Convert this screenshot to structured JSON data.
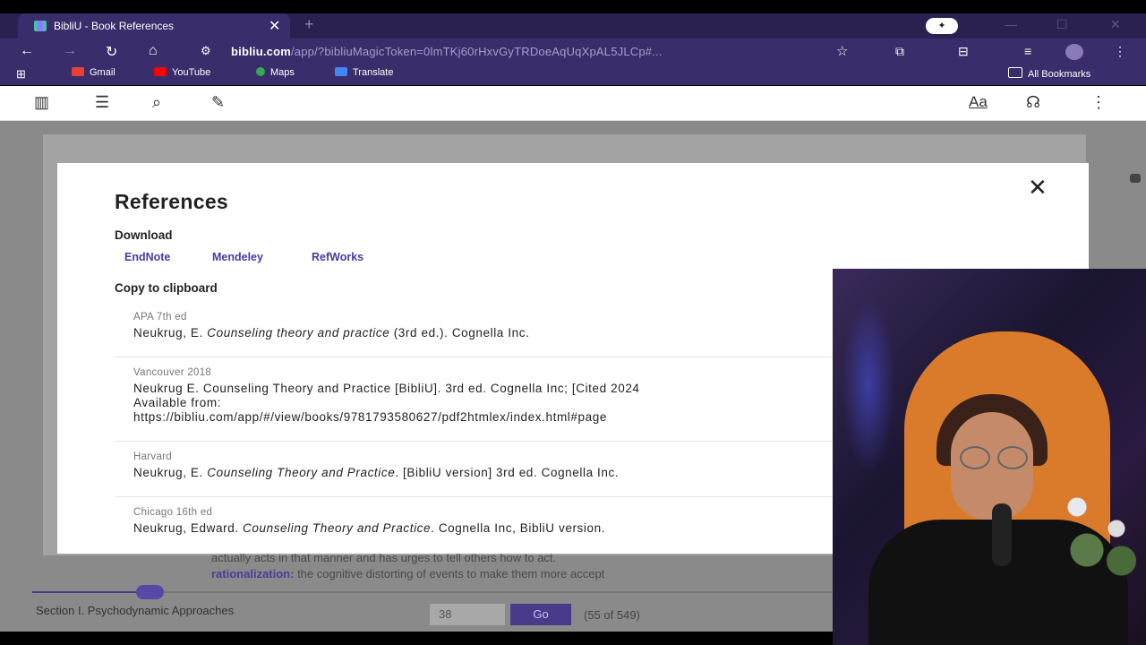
{
  "browser": {
    "tab_title": "BibliU - Book References",
    "tab_close": "✕",
    "new_tab": "+",
    "address_host": "bibliu.com",
    "address_path": "/app/?bibliuMagicToken=0lmTKj60rHxvGyTRDoeAqUqXpAL5JLCp#...",
    "bookmarks": [
      {
        "label": "Gmail",
        "color": "#e94235"
      },
      {
        "label": "YouTube",
        "color": "#ff0000"
      },
      {
        "label": "Maps",
        "color": "#34a853"
      },
      {
        "label": "Translate",
        "color": "#4285f4"
      }
    ],
    "all_bookmarks": "All Bookmarks"
  },
  "appbar": {
    "font_label": "Aa"
  },
  "modal": {
    "title": "References",
    "download_heading": "Download",
    "download_links": [
      "EndNote",
      "Mendeley",
      "RefWorks"
    ],
    "copy_heading": "Copy to clipboard",
    "citations": [
      {
        "style": "APA 7th ed",
        "author": "Neukrug, E. ",
        "title": "Counseling theory and practice",
        "rest": " (3rd ed.). Cognella Inc."
      },
      {
        "style": "Vancouver 2018",
        "line1": "Neukrug E. Counseling Theory and Practice [BibliU]. 3rd ed. Cognella Inc; [Cited 2024",
        "line2": "Available from:",
        "line3": "https://bibliu.com/app/#/view/books/9781793580627/pdf2htmlex/index.html#page"
      },
      {
        "style": "Harvard",
        "author": "Neukrug, E. ",
        "title": "Counseling Theory and Practice",
        "rest": ". [BibliU version] 3rd ed. Cognella Inc."
      },
      {
        "style": "Chicago 16th ed",
        "author": "Neukrug, Edward. ",
        "title": "Counseling Theory and Practice",
        "rest": ". Cognella Inc, BibliU version."
      }
    ]
  },
  "reader": {
    "bg_line1": "actually acts in that manner and has urges to tell others how to act.",
    "bg_term": "rationalization:",
    "bg_line2": " the cognitive distorting of events to make them more accept",
    "section_label": "Section I. Psychodynamic Approaches",
    "page_input": "38",
    "go_label": "Go",
    "page_count": "(55 of 549)"
  }
}
